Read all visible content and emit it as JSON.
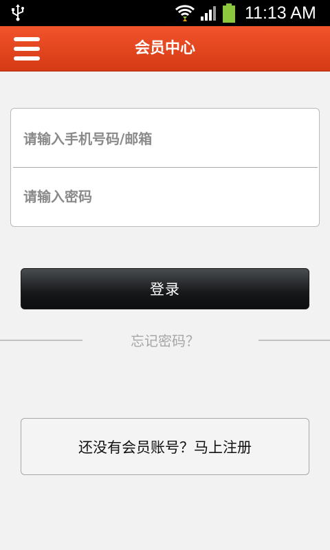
{
  "status_bar": {
    "time": "11:13 AM",
    "icons": [
      "usb-icon",
      "wifi-icon",
      "signal-icon",
      "battery-icon"
    ],
    "battery_color": "#8dc63f"
  },
  "app_bar": {
    "title": "会员中心",
    "menu_icon": "menu-icon",
    "color": "#e5461f"
  },
  "login_form": {
    "account_placeholder": "请输入手机号码/邮箱",
    "password_placeholder": "请输入密码",
    "login_label": "登录",
    "forgot_password": "忘记密码？"
  },
  "register": {
    "label": "还没有会员账号？马上注册"
  }
}
